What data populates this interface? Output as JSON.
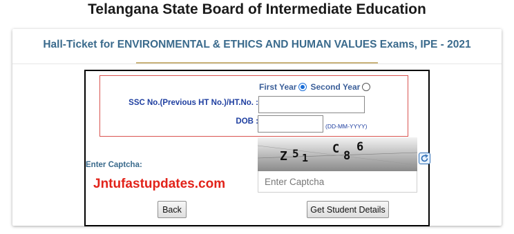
{
  "page": {
    "heading": "Telangana State Board of Intermediate Education"
  },
  "card": {
    "title": "Hall-Ticket for ENVIRONMENTAL & ETHICS AND HUMAN VALUES Exams, IPE - 2021"
  },
  "form": {
    "year_options": [
      {
        "label": "First Year",
        "selected": true
      },
      {
        "label": "Second Year",
        "selected": false
      }
    ],
    "ssc_label": "SSC No.(Previous HT No.)/HT.No.  :",
    "ssc_value": "",
    "dob_label": "DOB  :",
    "dob_value": "",
    "dob_hint": "(DD-MM-YYYY)",
    "captcha_label": "Enter Captcha:",
    "captcha_text": "Z51 C86",
    "captcha_placeholder": "Enter Captcha",
    "refresh_icon": "refresh-icon"
  },
  "watermark": {
    "text": "Jntufastupdates.com",
    "color": "#e2231a"
  },
  "buttons": {
    "back_label": "Back",
    "details_label": "Get Student Details"
  },
  "colors": {
    "title": "#3a6a8c",
    "label": "#1f3fa0",
    "error_border": "#d9534f",
    "underline": "#c9b37a"
  }
}
